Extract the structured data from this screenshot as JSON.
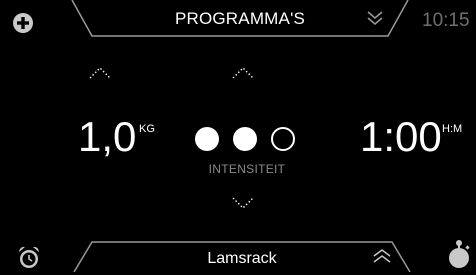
{
  "header": {
    "title": "PROGRAMMA'S",
    "clock": "10:15"
  },
  "weight": {
    "value": "1,0",
    "unit": "KG"
  },
  "intensity": {
    "label": "INTENSITEIT",
    "level": 2,
    "max": 3
  },
  "time": {
    "value": "1:00",
    "unit": "H:M"
  },
  "footer": {
    "title": "Lamsrack"
  },
  "icons": {
    "add": "plus-circle-icon",
    "alarm": "alarm-clock-icon",
    "timer": "timer-icon",
    "expand": "double-chevron-down-icon",
    "collapse": "double-chevron-up-icon"
  },
  "colors": {
    "background": "#000000",
    "frame": "#9a9a9a",
    "muted_text": "#8a8a8a",
    "clock_text": "#6f6f6f"
  }
}
